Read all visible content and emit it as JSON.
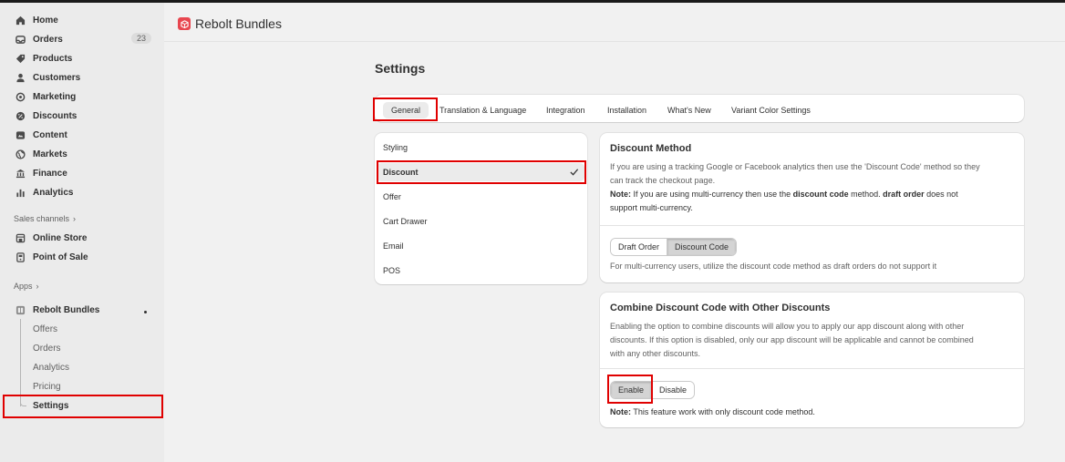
{
  "sidebar": {
    "nav": [
      {
        "label": "Home",
        "icon": "home-icon"
      },
      {
        "label": "Orders",
        "icon": "inbox-icon",
        "badge": "23"
      },
      {
        "label": "Products",
        "icon": "tag-icon"
      },
      {
        "label": "Customers",
        "icon": "person-icon"
      },
      {
        "label": "Marketing",
        "icon": "target-icon"
      },
      {
        "label": "Discounts",
        "icon": "discount-icon"
      },
      {
        "label": "Content",
        "icon": "content-icon"
      },
      {
        "label": "Markets",
        "icon": "globe-icon"
      },
      {
        "label": "Finance",
        "icon": "bank-icon"
      },
      {
        "label": "Analytics",
        "icon": "bar-chart-icon"
      }
    ],
    "sales_channels_label": "Sales channels",
    "channels": [
      {
        "label": "Online Store",
        "icon": "store-icon"
      },
      {
        "label": "Point of Sale",
        "icon": "pos-icon"
      }
    ],
    "apps_label": "Apps",
    "app": {
      "label": "Rebolt Bundles",
      "icon": "app-icon"
    },
    "app_subitems": [
      "Offers",
      "Orders",
      "Analytics",
      "Pricing",
      "Settings"
    ]
  },
  "header": {
    "app_title": "Rebolt Bundles"
  },
  "page": {
    "title": "Settings"
  },
  "tabs": [
    "General",
    "Translation & Language",
    "Integration",
    "Installation",
    "What's New",
    "Variant Color Settings"
  ],
  "settings_menu": [
    "Styling",
    "Discount",
    "Offer",
    "Cart Drawer",
    "Email",
    "POS"
  ],
  "discount_method": {
    "title": "Discount Method",
    "description_line1": "If you are using a tracking Google or Facebook analytics then use the 'Discount Code' method so they",
    "description_line2": "can track the checkout page.",
    "note_label": "Note:",
    "note_text1": " If you are using multi-currency then use the ",
    "note_bold1": "discount code",
    "note_text2": " method. ",
    "note_bold2": "draft order",
    "note_text3": " does not",
    "note_line2": "support multi-currency.",
    "options": [
      "Draft Order",
      "Discount Code"
    ],
    "selected": "Discount Code",
    "help": "For multi-currency users, utilize the discount code method as draft orders do not support it"
  },
  "combine": {
    "title": "Combine Discount Code with Other Discounts",
    "description_line1": "Enabling the option to combine discounts will allow you to apply our app discount along with other",
    "description_line2": "discounts. If this option is disabled, only our app discount will be applicable and cannot be combined",
    "description_line3": "with any other discounts.",
    "options": [
      "Enable",
      "Disable"
    ],
    "selected": "Enable",
    "note_label": "Note:",
    "note_text": " This feature work with only discount code method."
  },
  "colors": {
    "highlight": "#e00000",
    "selected_bg": "#ebebeb",
    "logo": "#e8464f"
  }
}
